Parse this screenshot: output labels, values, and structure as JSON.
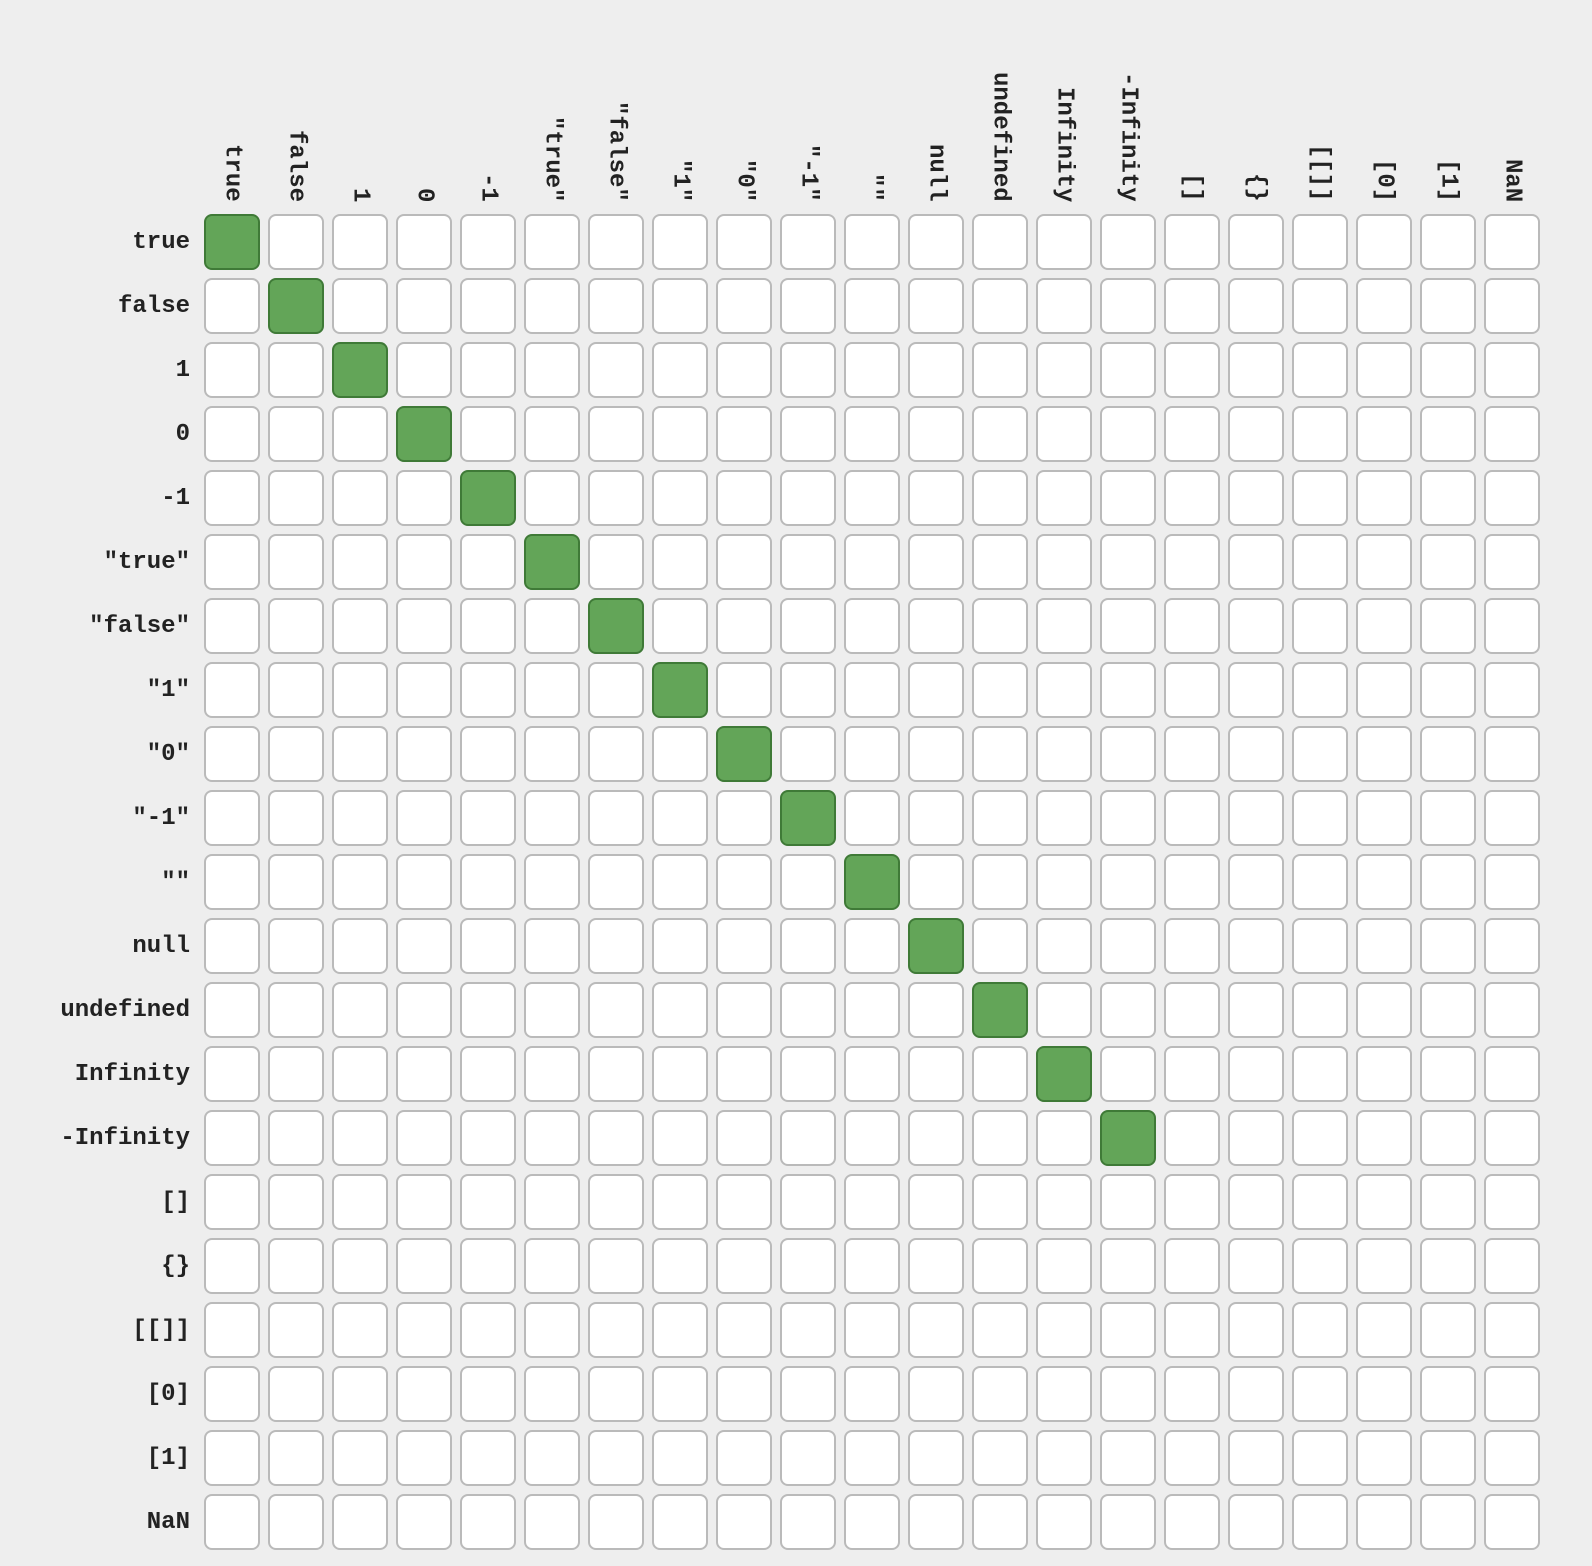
{
  "chart_data": {
    "type": "heatmap",
    "title": "",
    "xlabel": "",
    "ylabel": "",
    "categories": [
      "true",
      "false",
      "1",
      "0",
      "-1",
      "\"true\"",
      "\"false\"",
      "\"1\"",
      "\"0\"",
      "\"-1\"",
      "\"\"",
      "null",
      "undefined",
      "Infinity",
      "-Infinity",
      "[]",
      "{}",
      "[[]]",
      "[0]",
      "[1]",
      "NaN"
    ],
    "row_labels": [
      "true",
      "false",
      "1",
      "0",
      "-1",
      "\"true\"",
      "\"false\"",
      "\"1\"",
      "\"0\"",
      "\"-1\"",
      "\"\"",
      "null",
      "undefined",
      "Infinity",
      "-Infinity",
      "[]",
      "{}",
      "[[]]",
      "[0]",
      "[1]",
      "NaN"
    ],
    "matrix": [
      [
        1,
        0,
        0,
        0,
        0,
        0,
        0,
        0,
        0,
        0,
        0,
        0,
        0,
        0,
        0,
        0,
        0,
        0,
        0,
        0,
        0
      ],
      [
        0,
        1,
        0,
        0,
        0,
        0,
        0,
        0,
        0,
        0,
        0,
        0,
        0,
        0,
        0,
        0,
        0,
        0,
        0,
        0,
        0
      ],
      [
        0,
        0,
        1,
        0,
        0,
        0,
        0,
        0,
        0,
        0,
        0,
        0,
        0,
        0,
        0,
        0,
        0,
        0,
        0,
        0,
        0
      ],
      [
        0,
        0,
        0,
        1,
        0,
        0,
        0,
        0,
        0,
        0,
        0,
        0,
        0,
        0,
        0,
        0,
        0,
        0,
        0,
        0,
        0
      ],
      [
        0,
        0,
        0,
        0,
        1,
        0,
        0,
        0,
        0,
        0,
        0,
        0,
        0,
        0,
        0,
        0,
        0,
        0,
        0,
        0,
        0
      ],
      [
        0,
        0,
        0,
        0,
        0,
        1,
        0,
        0,
        0,
        0,
        0,
        0,
        0,
        0,
        0,
        0,
        0,
        0,
        0,
        0,
        0
      ],
      [
        0,
        0,
        0,
        0,
        0,
        0,
        1,
        0,
        0,
        0,
        0,
        0,
        0,
        0,
        0,
        0,
        0,
        0,
        0,
        0,
        0
      ],
      [
        0,
        0,
        0,
        0,
        0,
        0,
        0,
        1,
        0,
        0,
        0,
        0,
        0,
        0,
        0,
        0,
        0,
        0,
        0,
        0,
        0
      ],
      [
        0,
        0,
        0,
        0,
        0,
        0,
        0,
        0,
        1,
        0,
        0,
        0,
        0,
        0,
        0,
        0,
        0,
        0,
        0,
        0,
        0
      ],
      [
        0,
        0,
        0,
        0,
        0,
        0,
        0,
        0,
        0,
        1,
        0,
        0,
        0,
        0,
        0,
        0,
        0,
        0,
        0,
        0,
        0
      ],
      [
        0,
        0,
        0,
        0,
        0,
        0,
        0,
        0,
        0,
        0,
        1,
        0,
        0,
        0,
        0,
        0,
        0,
        0,
        0,
        0,
        0
      ],
      [
        0,
        0,
        0,
        0,
        0,
        0,
        0,
        0,
        0,
        0,
        0,
        1,
        0,
        0,
        0,
        0,
        0,
        0,
        0,
        0,
        0
      ],
      [
        0,
        0,
        0,
        0,
        0,
        0,
        0,
        0,
        0,
        0,
        0,
        0,
        1,
        0,
        0,
        0,
        0,
        0,
        0,
        0,
        0
      ],
      [
        0,
        0,
        0,
        0,
        0,
        0,
        0,
        0,
        0,
        0,
        0,
        0,
        0,
        1,
        0,
        0,
        0,
        0,
        0,
        0,
        0
      ],
      [
        0,
        0,
        0,
        0,
        0,
        0,
        0,
        0,
        0,
        0,
        0,
        0,
        0,
        0,
        1,
        0,
        0,
        0,
        0,
        0,
        0
      ],
      [
        0,
        0,
        0,
        0,
        0,
        0,
        0,
        0,
        0,
        0,
        0,
        0,
        0,
        0,
        0,
        0,
        0,
        0,
        0,
        0,
        0
      ],
      [
        0,
        0,
        0,
        0,
        0,
        0,
        0,
        0,
        0,
        0,
        0,
        0,
        0,
        0,
        0,
        0,
        0,
        0,
        0,
        0,
        0
      ],
      [
        0,
        0,
        0,
        0,
        0,
        0,
        0,
        0,
        0,
        0,
        0,
        0,
        0,
        0,
        0,
        0,
        0,
        0,
        0,
        0,
        0
      ],
      [
        0,
        0,
        0,
        0,
        0,
        0,
        0,
        0,
        0,
        0,
        0,
        0,
        0,
        0,
        0,
        0,
        0,
        0,
        0,
        0,
        0
      ],
      [
        0,
        0,
        0,
        0,
        0,
        0,
        0,
        0,
        0,
        0,
        0,
        0,
        0,
        0,
        0,
        0,
        0,
        0,
        0,
        0,
        0
      ],
      [
        0,
        0,
        0,
        0,
        0,
        0,
        0,
        0,
        0,
        0,
        0,
        0,
        0,
        0,
        0,
        0,
        0,
        0,
        0,
        0,
        0
      ]
    ],
    "colors": {
      "on": "#63a558",
      "off": "#ffffff",
      "border_on": "#3f7a37",
      "border_off": "#bababa"
    }
  }
}
